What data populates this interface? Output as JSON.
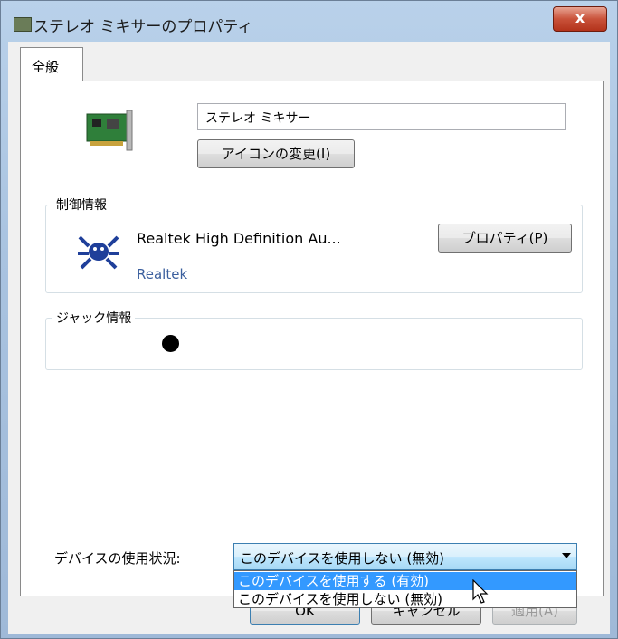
{
  "window": {
    "title": "ステレオ ミキサーのプロパティ",
    "close_label": "x"
  },
  "tabs": [
    {
      "label": "全般"
    }
  ],
  "device": {
    "name_value": "ステレオ ミキサー",
    "change_icon_label": "アイコンの変更(I)"
  },
  "control_info": {
    "label": "制御情報",
    "driver_name": "Realtek High Definition Au...",
    "driver_vendor": "Realtek",
    "properties_label": "プロパティ(P)"
  },
  "jack_info": {
    "label": "ジャック情報"
  },
  "usage": {
    "label": "デバイスの使用状況:",
    "selected": "このデバイスを使用しない (無効)",
    "options": [
      "このデバイスを使用する (有効)",
      "このデバイスを使用しない (無効)"
    ]
  },
  "footer": {
    "ok_label": "OK",
    "cancel_label": "キャンセル",
    "apply_label": "適用(A)"
  }
}
